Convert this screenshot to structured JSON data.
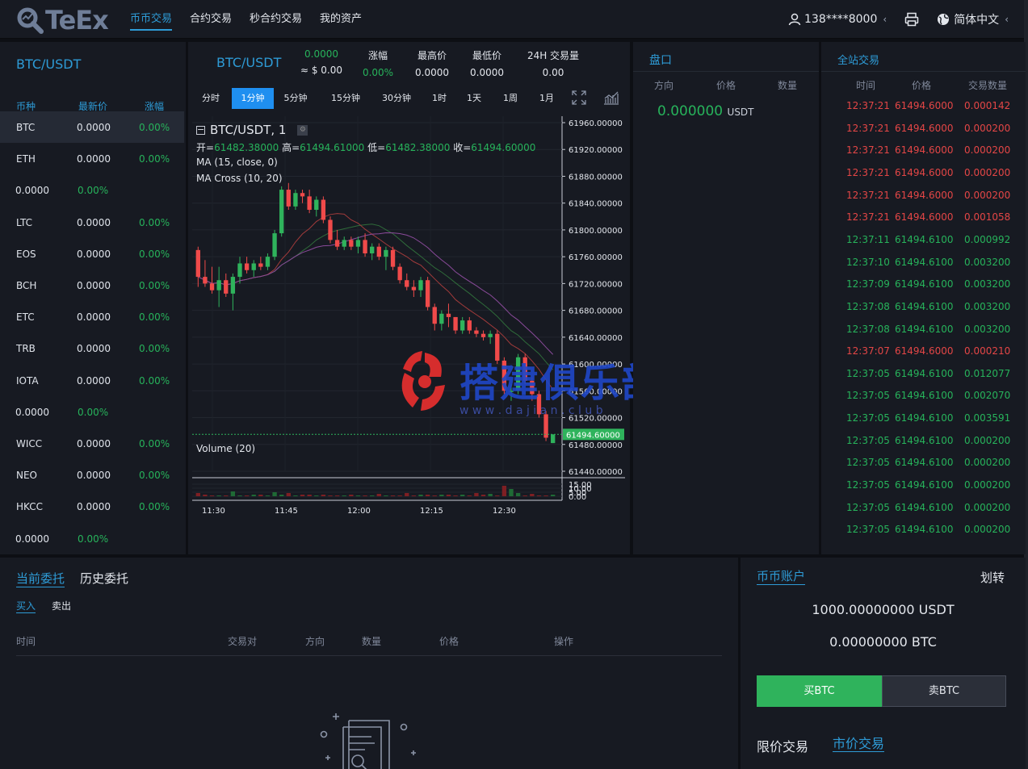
{
  "header": {
    "logo": "TeEx",
    "nav": [
      "币币交易",
      "合约交易",
      "秒合约交易",
      "我的资产"
    ],
    "user": "138****8000",
    "language": "简体中文"
  },
  "market": {
    "pair": "BTC/USDT",
    "cols": [
      "币种",
      "最新价",
      "涨幅"
    ],
    "rows": [
      {
        "coin": "BTC",
        "price": "0.0000",
        "change": "0.00%"
      },
      {
        "coin": "ETH",
        "price": "0.0000",
        "change": "0.00%"
      },
      {
        "coin": "",
        "price": "0.0000",
        "change": "0.00%"
      },
      {
        "coin": "LTC",
        "price": "0.0000",
        "change": "0.00%"
      },
      {
        "coin": "EOS",
        "price": "0.0000",
        "change": "0.00%"
      },
      {
        "coin": "BCH",
        "price": "0.0000",
        "change": "0.00%"
      },
      {
        "coin": "ETC",
        "price": "0.0000",
        "change": "0.00%"
      },
      {
        "coin": "TRB",
        "price": "0.0000",
        "change": "0.00%"
      },
      {
        "coin": "IOTA",
        "price": "0.0000",
        "change": "0.00%"
      },
      {
        "coin": "",
        "price": "0.0000",
        "change": "0.00%"
      },
      {
        "coin": "WICC",
        "price": "0.0000",
        "change": "0.00%"
      },
      {
        "coin": "NEO",
        "price": "0.0000",
        "change": "0.00%"
      },
      {
        "coin": "HKCC",
        "price": "0.0000",
        "change": "0.00%"
      },
      {
        "coin": "",
        "price": "0.0000",
        "change": "0.00%"
      }
    ]
  },
  "ticker": {
    "pair": "BTC/USDT",
    "last": "0.0000",
    "last_usd": "≈ $ 0.00",
    "change_label": "涨幅",
    "change": "0.00%",
    "high_label": "最高价",
    "high": "0.0000",
    "low_label": "最低价",
    "low": "0.0000",
    "vol_label": "24H 交易量",
    "vol": "0.00"
  },
  "timeframes": [
    "分时",
    "1分钟",
    "5分钟",
    "15分钟",
    "30分钟",
    "1时",
    "1天",
    "1周",
    "1月"
  ],
  "active_timeframe": "1分钟",
  "chart": {
    "symbol": "BTC/USDT, 1",
    "ohlc": {
      "o_label": "开=",
      "o": "61482.38000",
      "h_label": "高=",
      "h": "61494.61000",
      "l_label": "低=",
      "l": "61482.38000",
      "c_label": "收=",
      "c": "61494.60000"
    },
    "study1": "MA (15, close, 0)",
    "study2": "MA Cross (10, 20)",
    "volume_label": "Volume (20)",
    "last_price_tag": "61494.60000",
    "watermark_cn": "搭建俱乐部",
    "watermark_en": "w w w . d a j i a n . c l u b"
  },
  "chart_data": [
    {
      "type": "candlestick",
      "x_tick_labels": [
        "11:30",
        "11:45",
        "12:00",
        "12:15",
        "12:30"
      ],
      "y_tick_labels": [
        "61960.00000",
        "61920.00000",
        "61880.00000",
        "61840.00000",
        "61800.00000",
        "61760.00000",
        "61720.00000",
        "61680.00000",
        "61640.00000",
        "61600.00000",
        "61560.00000",
        "61520.00000",
        "61480.00000",
        "61440.00000"
      ],
      "ylim": [
        61440,
        61960
      ],
      "ohlc": [
        [
          61770,
          61775,
          61715,
          61730
        ],
        [
          61730,
          61755,
          61715,
          61720
        ],
        [
          61720,
          61745,
          61705,
          61710
        ],
        [
          61710,
          61745,
          61685,
          61725
        ],
        [
          61725,
          61735,
          61700,
          61705
        ],
        [
          61705,
          61735,
          61680,
          61730
        ],
        [
          61730,
          61760,
          61720,
          61750
        ],
        [
          61750,
          61760,
          61735,
          61740
        ],
        [
          61740,
          61755,
          61730,
          61750
        ],
        [
          61750,
          61760,
          61740,
          61745
        ],
        [
          61745,
          61765,
          61740,
          61760
        ],
        [
          61760,
          61800,
          61755,
          61795
        ],
        [
          61795,
          61865,
          61790,
          61860
        ],
        [
          61860,
          61870,
          61830,
          61835
        ],
        [
          61835,
          61860,
          61830,
          61855
        ],
        [
          61855,
          61860,
          61840,
          61850
        ],
        [
          61850,
          61860,
          61825,
          61830
        ],
        [
          61830,
          61850,
          61820,
          61845
        ],
        [
          61845,
          61850,
          61810,
          61815
        ],
        [
          61815,
          61820,
          61780,
          61785
        ],
        [
          61785,
          61800,
          61770,
          61775
        ],
        [
          61775,
          61790,
          61770,
          61785
        ],
        [
          61785,
          61790,
          61770,
          61775
        ],
        [
          61775,
          61790,
          61765,
          61785
        ],
        [
          61785,
          61795,
          61760,
          61765
        ],
        [
          61765,
          61780,
          61755,
          61775
        ],
        [
          61775,
          61780,
          61755,
          61760
        ],
        [
          61760,
          61775,
          61740,
          61770
        ],
        [
          61770,
          61775,
          61740,
          61745
        ],
        [
          61745,
          61750,
          61720,
          61725
        ],
        [
          61725,
          61735,
          61710,
          61715
        ],
        [
          61715,
          61725,
          61700,
          61710
        ],
        [
          61710,
          61730,
          61700,
          61725
        ],
        [
          61725,
          61730,
          61680,
          61685
        ],
        [
          61685,
          61690,
          61650,
          61660
        ],
        [
          61660,
          61680,
          61650,
          61675
        ],
        [
          61675,
          61690,
          61655,
          61670
        ],
        [
          61670,
          61670,
          61645,
          61650
        ],
        [
          61650,
          61670,
          61645,
          61665
        ],
        [
          61665,
          61670,
          61645,
          61650
        ],
        [
          61650,
          61655,
          61640,
          61645
        ],
        [
          61645,
          61650,
          61635,
          61640
        ],
        [
          61640,
          61650,
          61630,
          61645
        ],
        [
          61645,
          61650,
          61600,
          61605
        ],
        [
          61605,
          61610,
          61555,
          61560
        ],
        [
          61560,
          61570,
          61545,
          61560
        ],
        [
          61560,
          61615,
          61555,
          61610
        ],
        [
          61610,
          61615,
          61570,
          61575
        ],
        [
          61575,
          61580,
          61545,
          61555
        ],
        [
          61555,
          61560,
          61520,
          61525
        ],
        [
          61525,
          61530,
          61485,
          61490
        ],
        [
          61482,
          61495,
          61482,
          61495
        ]
      ]
    },
    {
      "type": "bar",
      "series": [
        {
          "name": "Volume (20)",
          "values": [
            4,
            2,
            1,
            1,
            1,
            6,
            1,
            1,
            2,
            2,
            1,
            5,
            2,
            4,
            1,
            2,
            2,
            1,
            2,
            1,
            1,
            1,
            2,
            1,
            1,
            1,
            3,
            1,
            1,
            1,
            4,
            1,
            2,
            2,
            1,
            2,
            2,
            1,
            2,
            1,
            4,
            2,
            3,
            1,
            13,
            9,
            4,
            1,
            3,
            1,
            1,
            2
          ]
        }
      ],
      "y_tick_labels": [
        "15.00",
        "10.00",
        "5.00",
        "0.00"
      ],
      "ylim": [
        0,
        16
      ]
    }
  ],
  "depth": {
    "title": "盘口",
    "cols": [
      "方向",
      "价格",
      "数量"
    ],
    "price": "0.000000",
    "unit": "USDT"
  },
  "trades": {
    "title": "全站交易",
    "cols": [
      "时间",
      "价格",
      "交易数量"
    ],
    "rows": [
      {
        "time": "12:37:21",
        "price": "61494.6000",
        "amount": "0.000142",
        "side": "sell"
      },
      {
        "time": "12:37:21",
        "price": "61494.6000",
        "amount": "0.000200",
        "side": "sell"
      },
      {
        "time": "12:37:21",
        "price": "61494.6000",
        "amount": "0.000200",
        "side": "sell"
      },
      {
        "time": "12:37:21",
        "price": "61494.6000",
        "amount": "0.000200",
        "side": "sell"
      },
      {
        "time": "12:37:21",
        "price": "61494.6000",
        "amount": "0.000200",
        "side": "sell"
      },
      {
        "time": "12:37:21",
        "price": "61494.6000",
        "amount": "0.001058",
        "side": "sell"
      },
      {
        "time": "12:37:11",
        "price": "61494.6100",
        "amount": "0.000992",
        "side": "buy"
      },
      {
        "time": "12:37:10",
        "price": "61494.6100",
        "amount": "0.003200",
        "side": "buy"
      },
      {
        "time": "12:37:09",
        "price": "61494.6100",
        "amount": "0.003200",
        "side": "buy"
      },
      {
        "time": "12:37:08",
        "price": "61494.6100",
        "amount": "0.003200",
        "side": "buy"
      },
      {
        "time": "12:37:08",
        "price": "61494.6100",
        "amount": "0.003200",
        "side": "buy"
      },
      {
        "time": "12:37:07",
        "price": "61494.6000",
        "amount": "0.000210",
        "side": "sell"
      },
      {
        "time": "12:37:05",
        "price": "61494.6100",
        "amount": "0.012077",
        "side": "buy"
      },
      {
        "time": "12:37:05",
        "price": "61494.6100",
        "amount": "0.002070",
        "side": "buy"
      },
      {
        "time": "12:37:05",
        "price": "61494.6100",
        "amount": "0.003591",
        "side": "buy"
      },
      {
        "time": "12:37:05",
        "price": "61494.6100",
        "amount": "0.000200",
        "side": "buy"
      },
      {
        "time": "12:37:05",
        "price": "61494.6100",
        "amount": "0.000200",
        "side": "buy"
      },
      {
        "time": "12:37:05",
        "price": "61494.6100",
        "amount": "0.000200",
        "side": "buy"
      },
      {
        "time": "12:37:05",
        "price": "61494.6100",
        "amount": "0.000200",
        "side": "buy"
      },
      {
        "time": "12:37:05",
        "price": "61494.6100",
        "amount": "0.000200",
        "side": "buy"
      }
    ]
  },
  "orders": {
    "tab_current": "当前委托",
    "tab_history": "历史委托",
    "sub_buy": "买入",
    "sub_sell": "卖出",
    "cols": [
      "时间",
      "交易对",
      "方向",
      "数量",
      "价格",
      "操作"
    ]
  },
  "account": {
    "title": "币币账户",
    "transfer": "划转",
    "usdt_balance": "1000.00000000 USDT",
    "btc_balance": "0.00000000 BTC",
    "buy_label": "买BTC",
    "sell_label": "卖BTC",
    "limit_tab": "限价交易",
    "market_tab": "市价交易"
  },
  "colors": {
    "accent": "#2e9bd6",
    "up": "#27b35b",
    "down": "#e44646",
    "panel": "#171a22"
  }
}
